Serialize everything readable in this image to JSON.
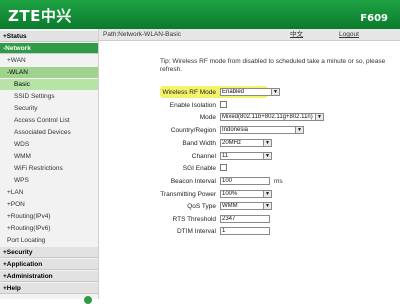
{
  "header": {
    "logo": "ZTE中兴",
    "model": "F609"
  },
  "sidebar": {
    "items": [
      {
        "label": "+Status"
      },
      {
        "label": "-Network"
      },
      {
        "label": "+WAN"
      },
      {
        "label": "-WLAN"
      },
      {
        "label": "Basic"
      },
      {
        "label": "SSID Settings"
      },
      {
        "label": "Security"
      },
      {
        "label": "Access Control List"
      },
      {
        "label": "Associated Devices"
      },
      {
        "label": "WDS"
      },
      {
        "label": "WMM"
      },
      {
        "label": "WiFi Restrictions"
      },
      {
        "label": "WPS"
      },
      {
        "label": "+LAN"
      },
      {
        "label": "+PON"
      },
      {
        "label": "+Routing(IPv4)"
      },
      {
        "label": "+Routing(IPv6)"
      },
      {
        "label": "Port Locating"
      },
      {
        "label": "+Security"
      },
      {
        "label": "+Application"
      },
      {
        "label": "+Administration"
      },
      {
        "label": "+Help"
      }
    ]
  },
  "topbar": {
    "path": "Path:Network-WLAN-Basic",
    "lang": "中文",
    "logout": "Logout"
  },
  "tip": "Tip: Wireless RF mode from disabled to scheduled take a minute or so, please refresh.",
  "form": {
    "rf_mode": {
      "label": "Wireless RF Mode",
      "value": "Enabled"
    },
    "isolation": {
      "label": "Enable Isolation"
    },
    "mode": {
      "label": "Mode",
      "value": "Mixed(802.11b+802.11g+802.11n)"
    },
    "country": {
      "label": "Country/Region",
      "value": "Indonesia"
    },
    "bandwidth": {
      "label": "Band Width",
      "value": "20MHz"
    },
    "channel": {
      "label": "Channel",
      "value": "11"
    },
    "sgi": {
      "label": "SGI Enable"
    },
    "beacon": {
      "label": "Beacon Interval",
      "value": "100",
      "unit": "ms"
    },
    "power": {
      "label": "Transmitting Power",
      "value": "100%"
    },
    "qos": {
      "label": "QoS Type",
      "value": "WMM"
    },
    "rts": {
      "label": "RTS Threshold",
      "value": "2347"
    },
    "dtim": {
      "label": "DTIM Interval",
      "value": "1"
    }
  }
}
